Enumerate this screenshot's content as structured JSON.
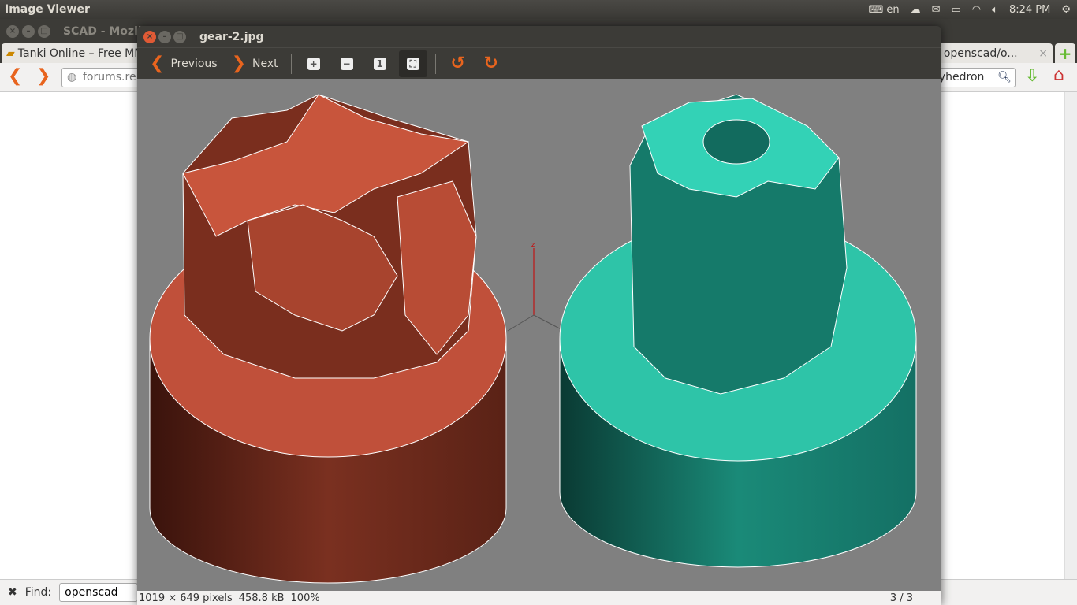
{
  "panel": {
    "app_title": "Image Viewer",
    "tray": {
      "keyboard_layout": "en",
      "clock": "8:24 PM"
    },
    "icons": [
      "keyboard-icon",
      "cloud-icon",
      "mail-icon",
      "battery-icon",
      "wifi-icon",
      "volume-icon",
      "power-gear-icon"
    ]
  },
  "firefox": {
    "window_title": "SCAD - Mozilla Firefox",
    "tabs": [
      {
        "label": "Tanki Online – Free MMO"
      },
      {
        "label": "ue · openscad/o..."
      }
    ],
    "url": "forums.re",
    "search_value": "lyhedron",
    "find_label": "Find:",
    "find_value": "openscad"
  },
  "viewer": {
    "title": "gear-2.jpg",
    "toolbar": {
      "previous": "Previous",
      "next": "Next",
      "zoom_in": "+",
      "zoom_out": "−",
      "normal_size": "1"
    },
    "status": {
      "dimensions": "1019 × 649 pixels",
      "size": "458.8 kB",
      "zoom": "100%",
      "position": "3 / 3"
    },
    "image": {
      "axis_label": "z",
      "colors": {
        "left_gear": "#c0503a",
        "right_gear": "#2ec4a8",
        "background": "#808080"
      }
    }
  }
}
